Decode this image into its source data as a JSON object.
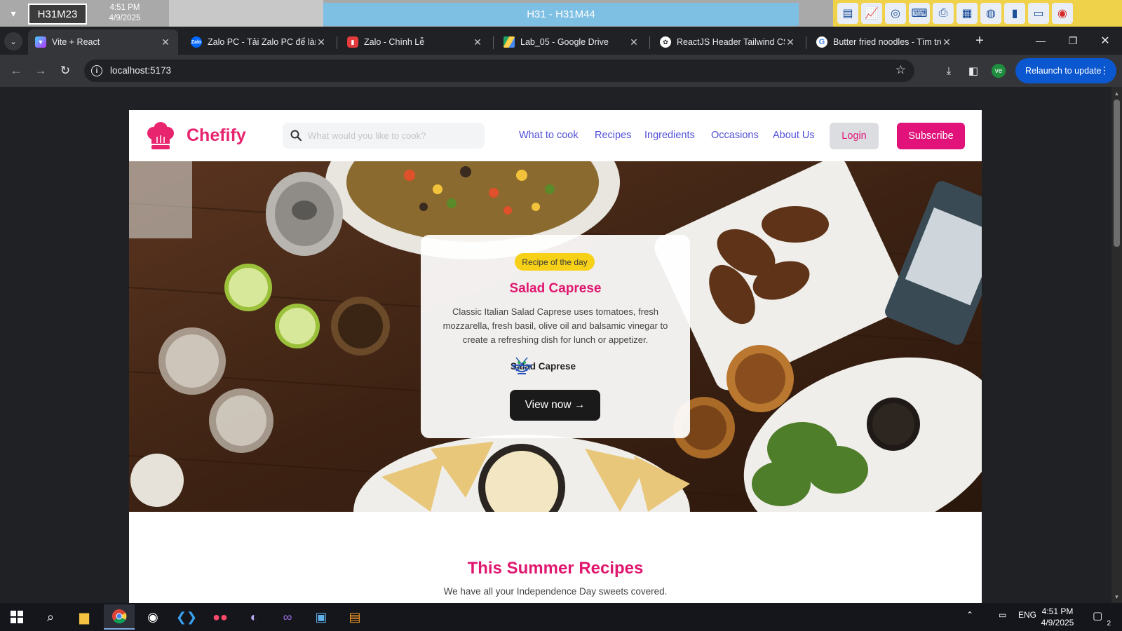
{
  "session": {
    "machine_id": "H31M23",
    "time": "4:51 PM",
    "date": "4/9/2025",
    "title": "H31 - H31M44"
  },
  "tabs": [
    {
      "label": "Vite + React",
      "icon": "vite-icon",
      "active": true
    },
    {
      "label": "Zalo PC - Tải Zalo PC để làm",
      "icon": "zalo-icon"
    },
    {
      "label": "Zalo - Chính Lễ",
      "icon": "zalo-red-icon"
    },
    {
      "label": "Lab_05 - Google Drive",
      "icon": "google-drive-icon"
    },
    {
      "label": "ReactJS Header Tailwind CSS",
      "icon": "openai-icon"
    },
    {
      "label": "Butter fried noodles - Tìm trên",
      "icon": "google-icon"
    }
  ],
  "toolbar": {
    "url": "localhost:5173",
    "profile_initials": "ve",
    "relaunch_label": "Relaunch to update"
  },
  "site": {
    "brand": "Chefify",
    "brand_color": "#e8246f",
    "search_placeholder": "What would you like to cook?",
    "nav": [
      "What to cook",
      "Recipes",
      "Ingredients",
      "Occasions",
      "About Us"
    ],
    "login_label": "Login",
    "subscribe_label": "Subscribe"
  },
  "hero_card": {
    "badge": "Recipe of the day",
    "title": "Salad Caprese",
    "description": "Classic Italian Salad Caprese uses tomatoes, fresh mozzarella, fresh basil, olive oil and balsamic vinegar to create a refreshing dish for lunch or appetizer.",
    "author": "Salad Caprese",
    "cta": "View now →"
  },
  "section": {
    "title": "This Summer Recipes",
    "subtitle": "We have all your Independence Day sweets covered."
  },
  "taskbar": {
    "language": "ENG",
    "time": "4:51 PM",
    "date": "4/9/2025",
    "notifications": "2"
  }
}
